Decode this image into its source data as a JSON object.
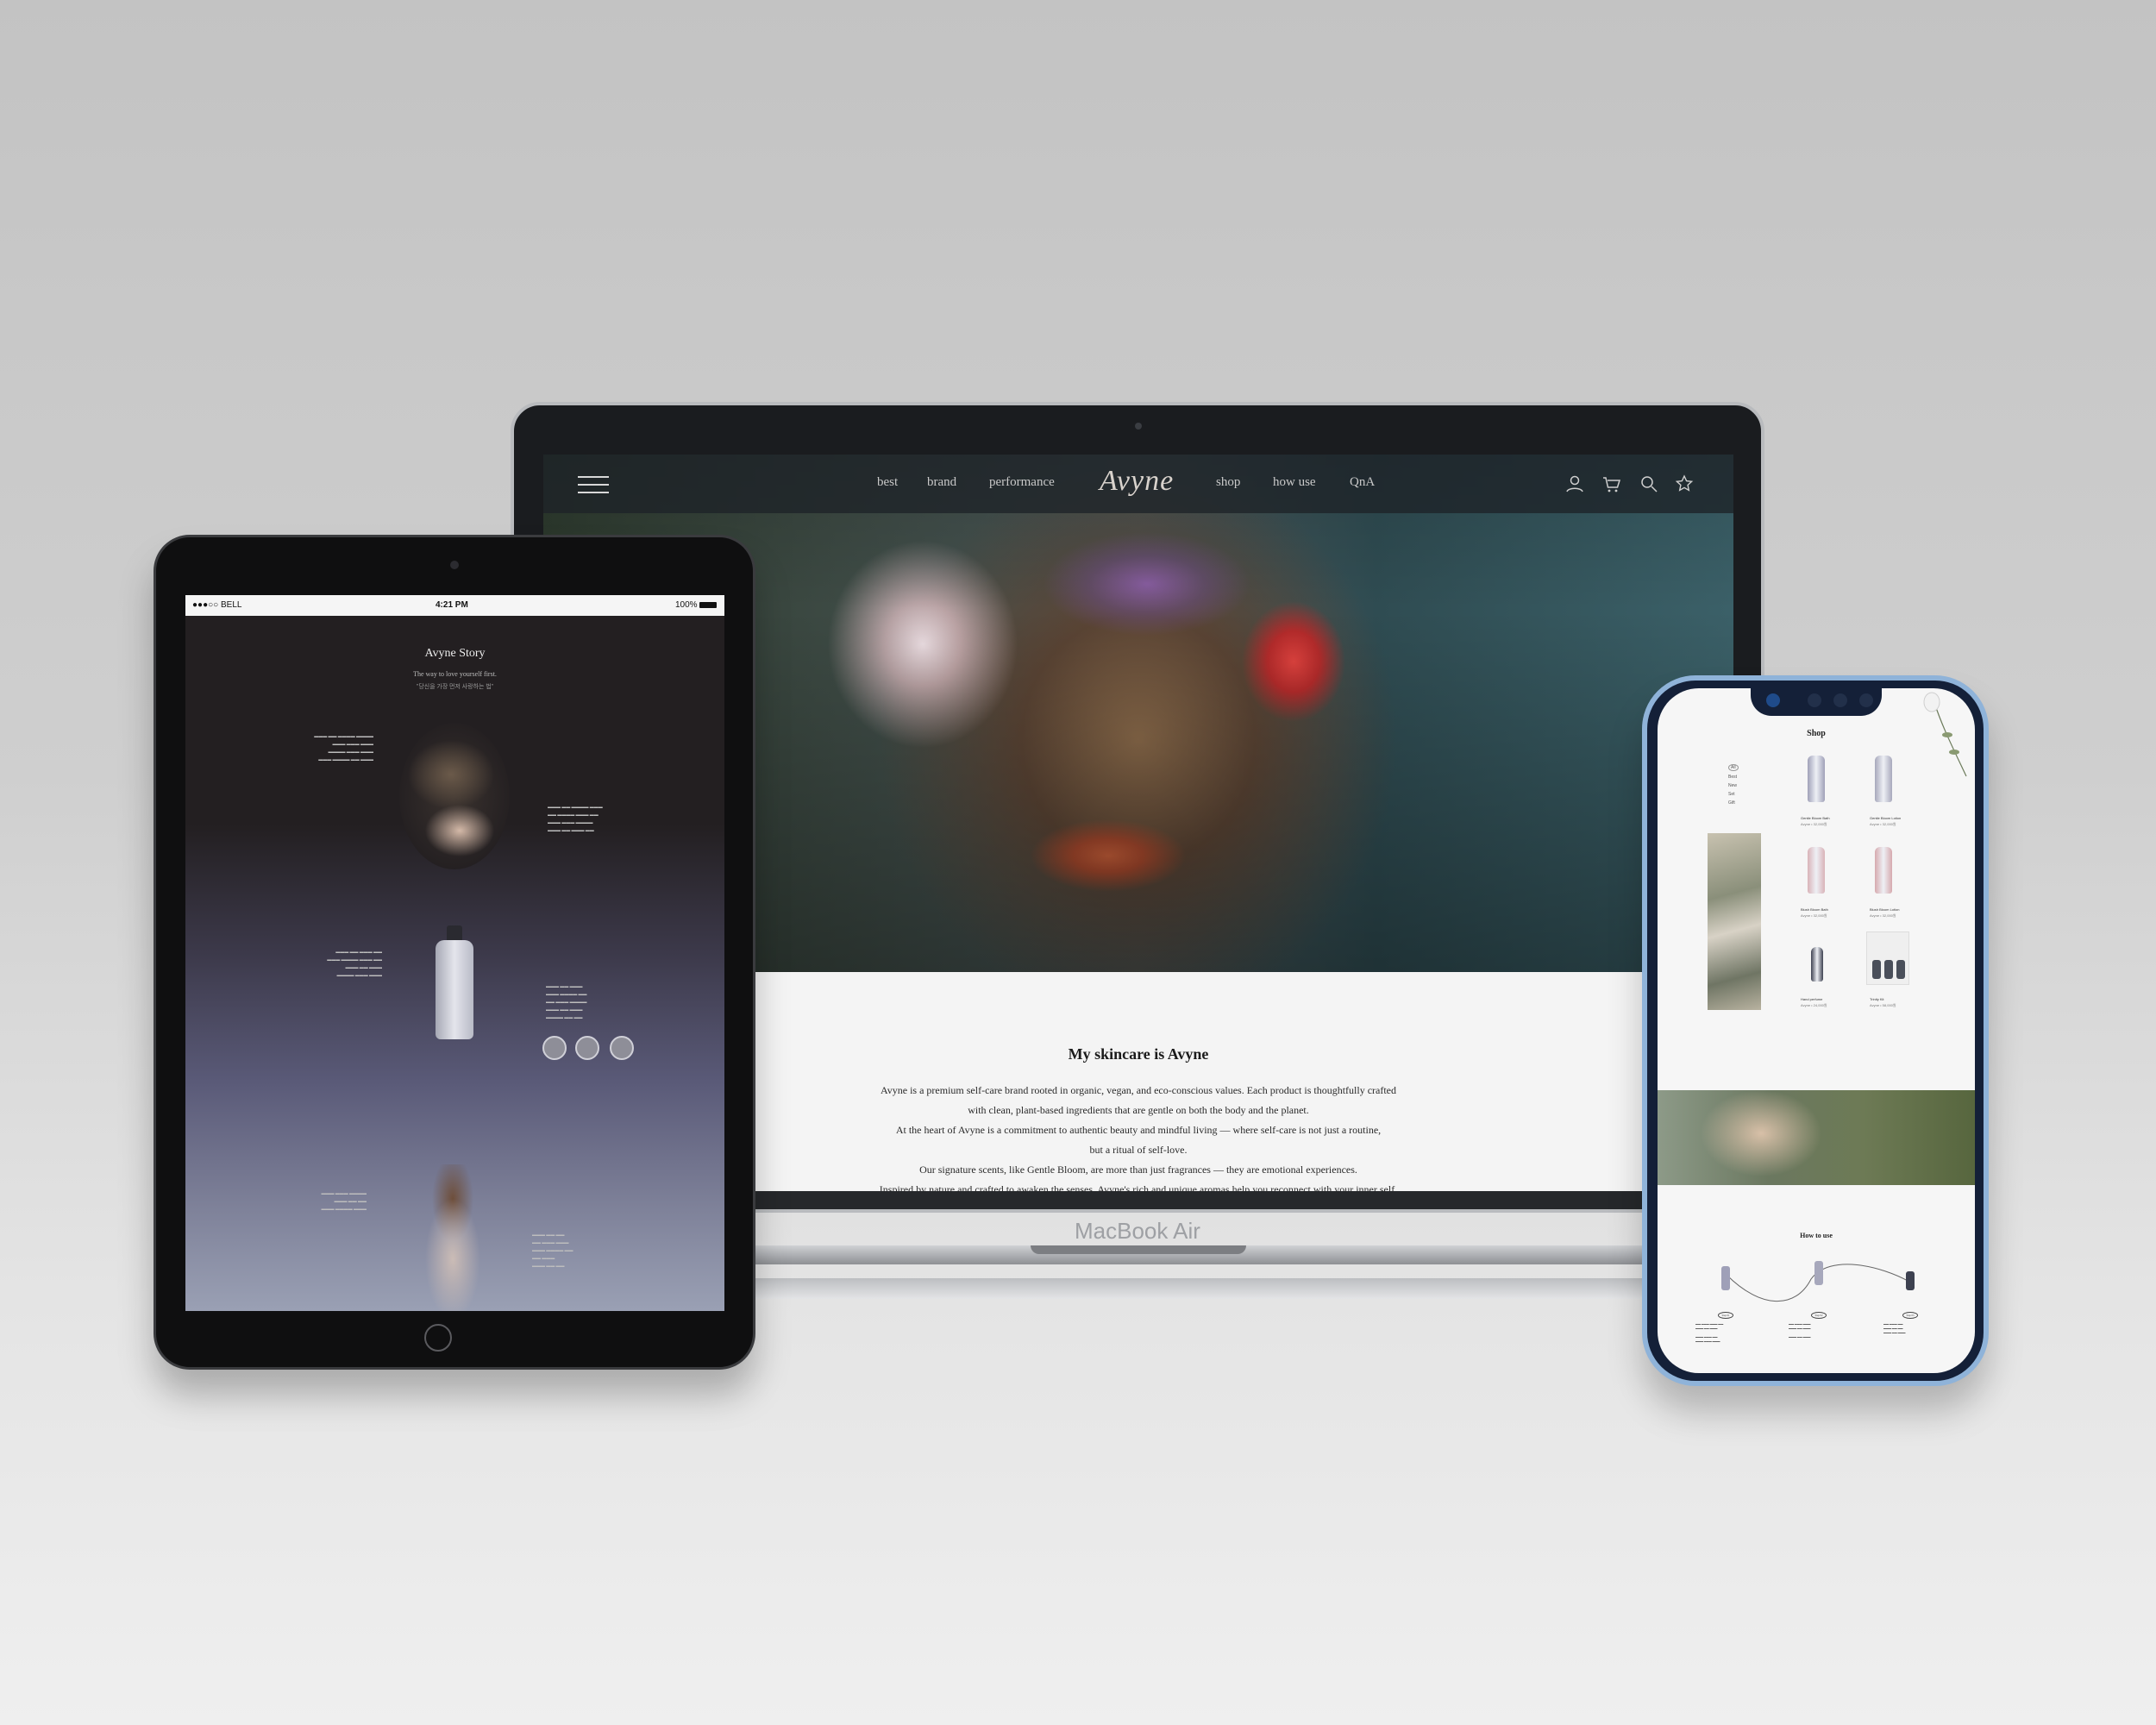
{
  "laptop": {
    "label": "MacBook Air",
    "nav": {
      "links_left": [
        "best",
        "brand",
        "performance"
      ],
      "logo": "Avyne",
      "links_right": [
        "shop",
        "how use",
        "QnA"
      ],
      "icons": [
        "user-icon",
        "cart-icon",
        "search-icon",
        "star-icon"
      ]
    },
    "about": {
      "title": "My skincare is Avyne",
      "lines": [
        "Avyne is a premium self-care brand rooted in organic, vegan, and eco-conscious values. Each product is thoughtfully crafted",
        "with clean, plant-based ingredients that are gentle on both the body and the planet.",
        "At the heart of Avyne is a commitment to authentic beauty and mindful living — where self-care is not just a routine,",
        "but a ritual of self-love.",
        "Our signature scents, like Gentle Bloom, are more than just fragrances — they are emotional experiences.",
        "Inspired by nature and crafted to awaken the senses, Avyne's rich and unique aromas help you reconnect with your inner self."
      ]
    }
  },
  "tablet": {
    "status": {
      "carrier": "●●●○○ BELL",
      "time": "4:21 PM",
      "battery": "100%"
    },
    "story": {
      "title": "Avyne Story",
      "subtitle": "The way to love yourself first.",
      "quote": "\"당신을 가장 먼저 사랑하는 법\""
    }
  },
  "phone": {
    "shop_title": "Shop",
    "filters": [
      "All",
      "Best",
      "New",
      "Set",
      "Gift"
    ],
    "products": [
      {
        "name": "Gentle Bloom Bath",
        "price": "Avyne • 32,000원",
        "color": "#9fa0b8"
      },
      {
        "name": "Gentle Bloom Lotion",
        "price": "Avyne • 32,000원",
        "color": "#a7a8bc"
      },
      {
        "name": "Blush Bloom Bath",
        "price": "Avyne • 32,000원",
        "color": "#d9b3b8"
      },
      {
        "name": "Blush Bloom Lotion",
        "price": "Avyne • 32,000원",
        "color": "#d6a9ae"
      },
      {
        "name": "Hand perfume",
        "price": "Avyne • 24,000원",
        "color": "#3d4150"
      },
      {
        "name": "Trinity Kit",
        "price": "Avyne • 58,000원",
        "color": "#4a4f5a"
      }
    ],
    "howto_title": "How to use",
    "steps": [
      "Step 01",
      "Step 02",
      "Step 03"
    ]
  },
  "colors": {
    "accent": "#1b1b1b",
    "phone_frame": "#8fb3d9",
    "tablet_gradient_end": "#9aa0b4"
  }
}
